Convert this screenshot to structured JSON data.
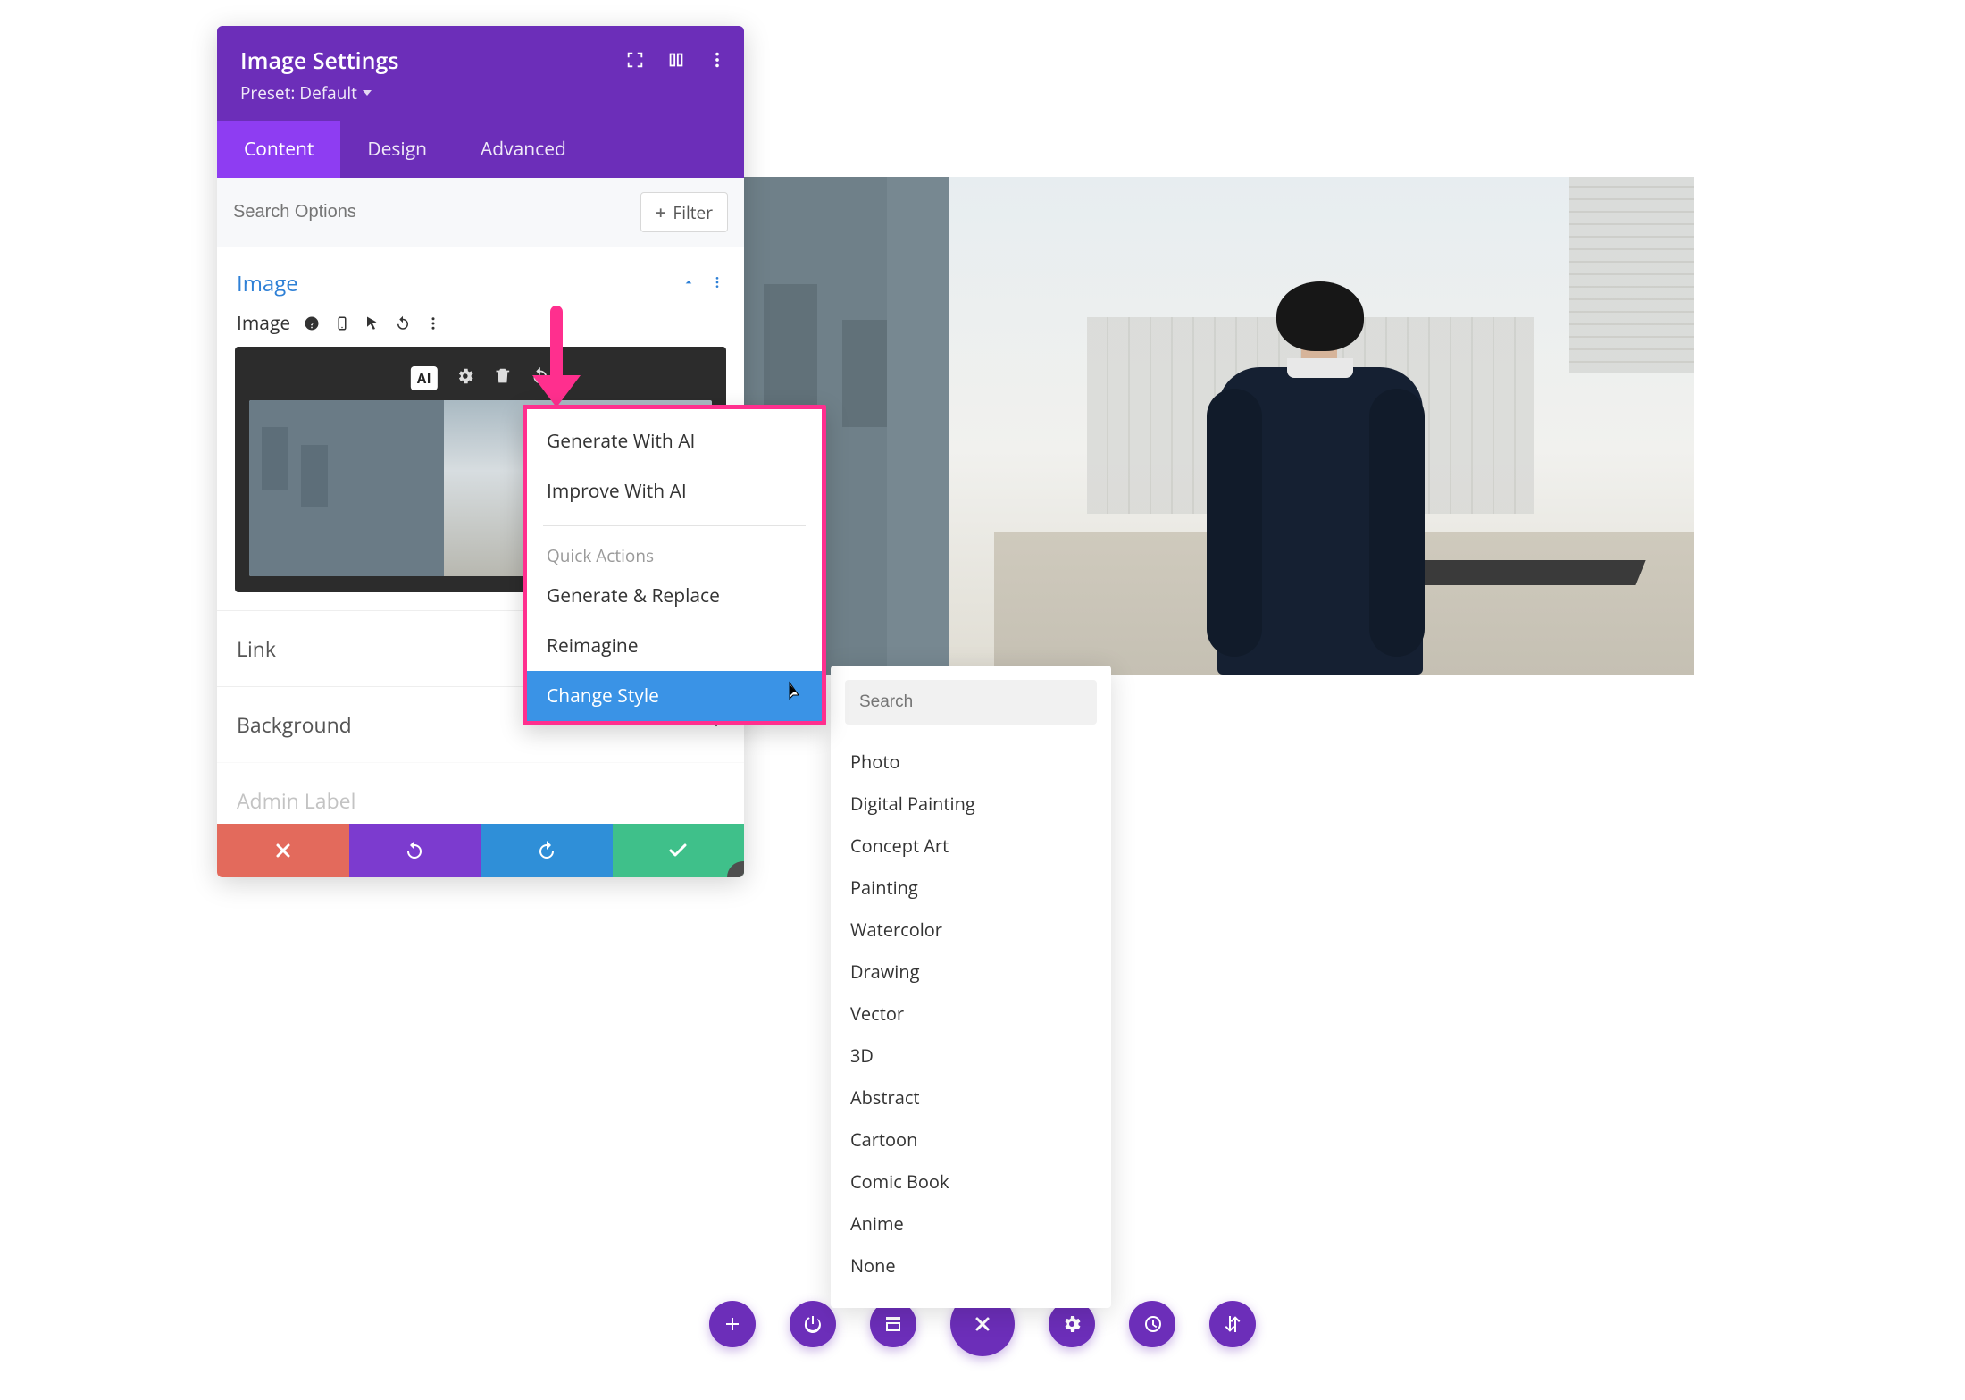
{
  "panel": {
    "title": "Image Settings",
    "preset": "Preset: Default",
    "tabs": {
      "content": "Content",
      "design": "Design",
      "advanced": "Advanced"
    },
    "search_placeholder": "Search Options",
    "filter_label": "Filter",
    "section_title": "Image",
    "image_label": "Image",
    "rows": {
      "link": "Link",
      "background": "Background",
      "admin_label": "Admin Label"
    }
  },
  "ai_menu": {
    "generate": "Generate With AI",
    "improve": "Improve With AI",
    "quick_actions_label": "Quick Actions",
    "generate_replace": "Generate & Replace",
    "reimagine": "Reimagine",
    "change_style": "Change Style"
  },
  "style_panel": {
    "search_placeholder": "Search",
    "options": [
      "Photo",
      "Digital Painting",
      "Concept Art",
      "Painting",
      "Watercolor",
      "Drawing",
      "Vector",
      "3D",
      "Abstract",
      "Cartoon",
      "Comic Book",
      "Anime",
      "None"
    ]
  },
  "toolbar_icons": {
    "ai_badge": "AI"
  },
  "colors": {
    "purple": "#6c2eb9",
    "purple_light": "#8e3df2",
    "pink": "#ff2f8e",
    "blue": "#3a93e6",
    "green": "#3fc08a",
    "red": "#e36a5c"
  }
}
